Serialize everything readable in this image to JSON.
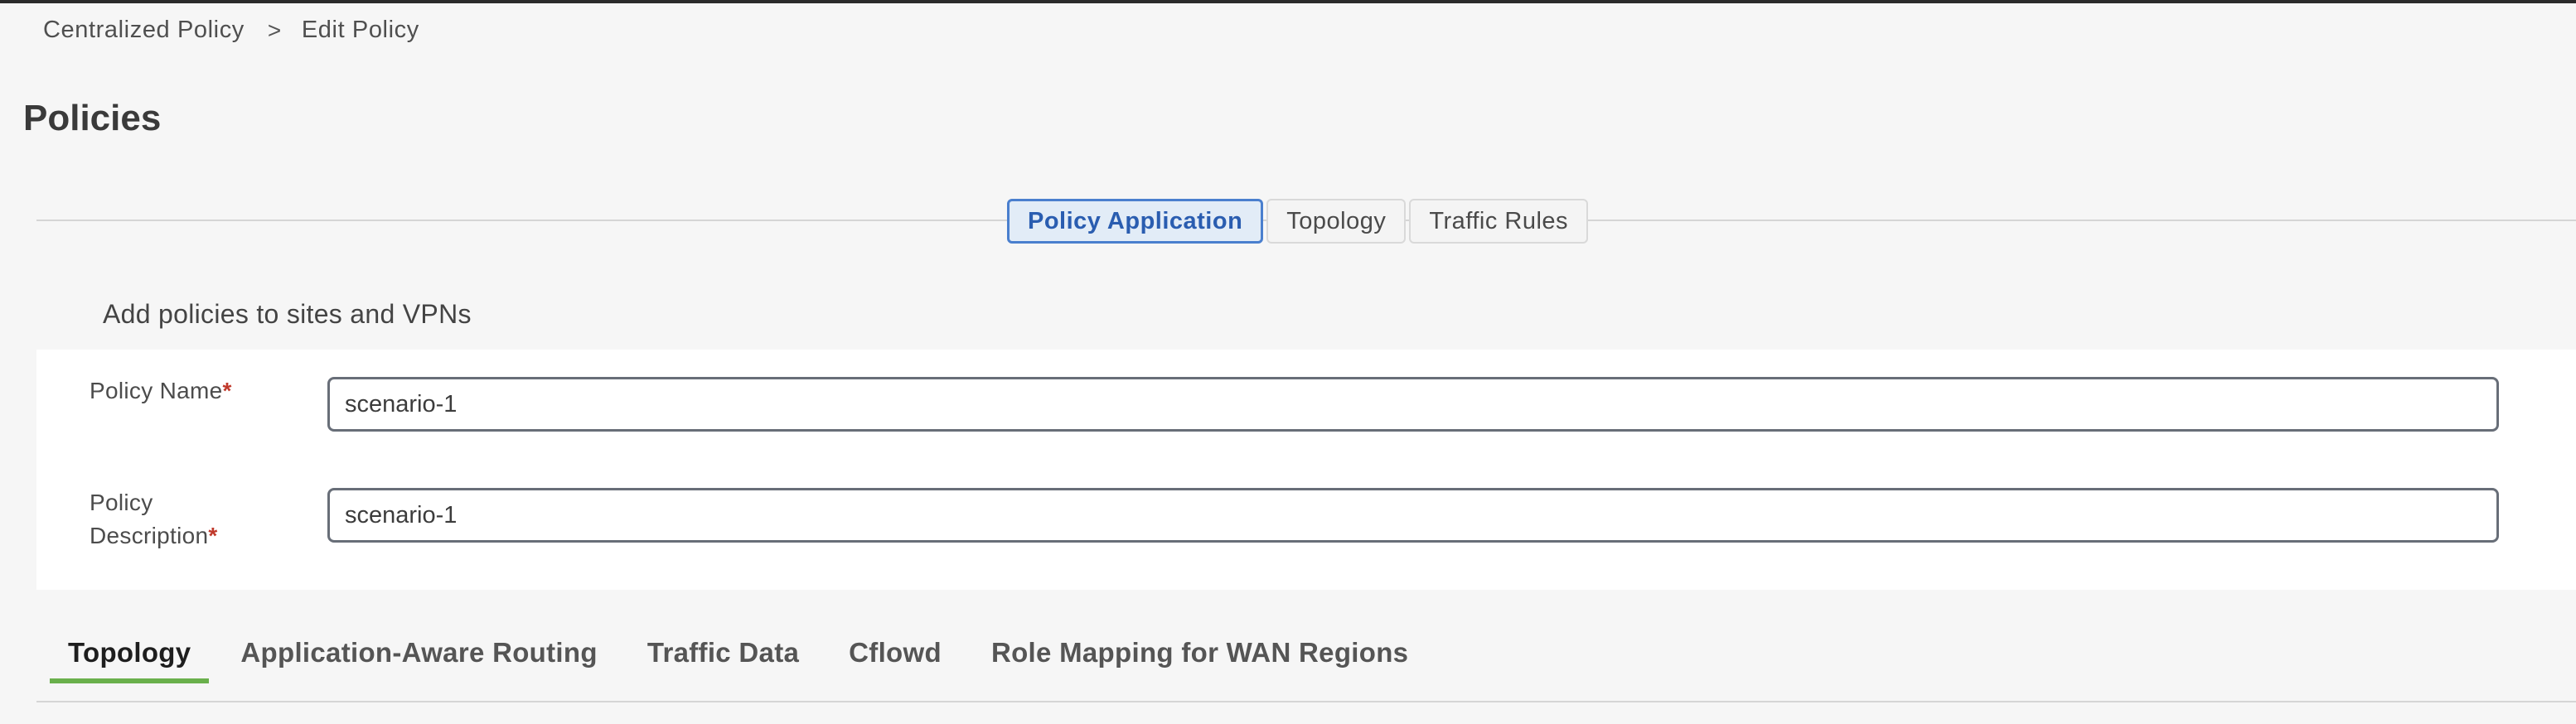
{
  "breadcrumb": {
    "items": [
      "Centralized Policy",
      "Edit Policy"
    ],
    "separator": ">"
  },
  "page": {
    "title": "Policies"
  },
  "segmented_tabs": [
    {
      "label": "Policy Application",
      "active": true
    },
    {
      "label": "Topology",
      "active": false
    },
    {
      "label": "Traffic Rules",
      "active": false
    }
  ],
  "section": {
    "heading": "Add policies to sites and VPNs"
  },
  "form": {
    "policy_name_label": "Policy Name",
    "policy_name_value": "scenario-1",
    "policy_description_label_line1": "Policy",
    "policy_description_label_line2": "Description",
    "policy_description_value": "scenario-1",
    "required_marker": "*"
  },
  "bottom_tabs": [
    {
      "label": "Topology",
      "active": true
    },
    {
      "label": "Application-Aware Routing",
      "active": false
    },
    {
      "label": "Traffic Data",
      "active": false
    },
    {
      "label": "Cflowd",
      "active": false
    },
    {
      "label": "Role Mapping for WAN Regions",
      "active": false
    }
  ],
  "colors": {
    "accent_blue": "#4a7fce",
    "active_tab_underline": "#6ab04c",
    "required": "#c0392b"
  }
}
